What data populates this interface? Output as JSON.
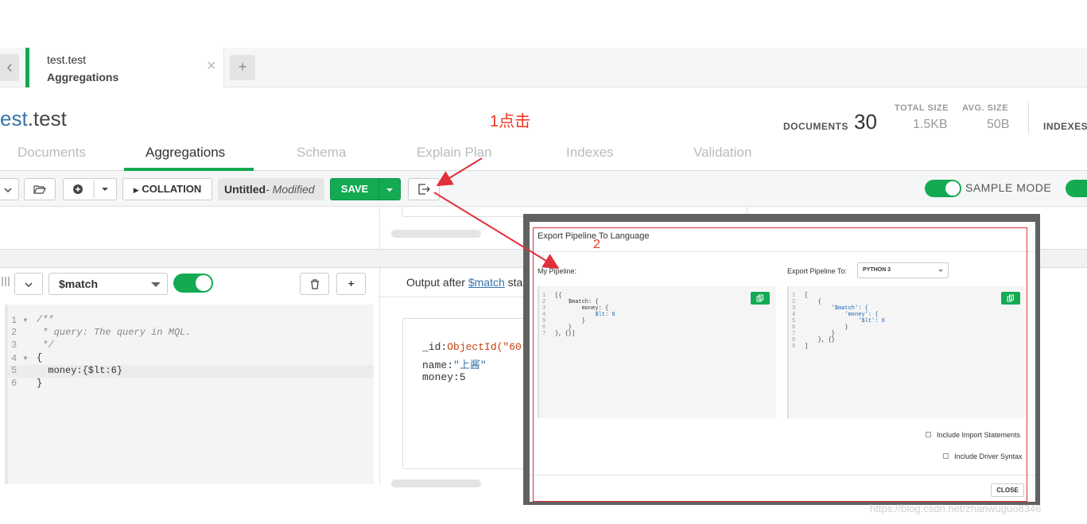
{
  "tabs": {
    "namespace": "test.test",
    "subtitle": "Aggregations",
    "close_glyph": "×",
    "add_glyph": "+",
    "back_glyph": "‹"
  },
  "header": {
    "db": "est",
    "coll": ".test",
    "annotation_1": "1点击",
    "documents_label": "DOCUMENTS",
    "documents_value": "30",
    "total_size_label": "TOTAL SIZE",
    "total_size_value": "1.5KB",
    "avg_size_label": "AVG. SIZE",
    "avg_size_value": "50B",
    "indexes_label": "INDEXES"
  },
  "main_tabs": [
    "Documents",
    "Aggregations",
    "Schema",
    "Explain Plan",
    "Indexes",
    "Validation"
  ],
  "toolbar": {
    "collation_label": "COLLATION",
    "pipeline_name": "Untitled",
    "modified_label": "- Modified",
    "save_label": "SAVE",
    "sample_mode_label": "SAMPLE MODE"
  },
  "stage": {
    "operator": "$match",
    "delete_glyph": "🗑",
    "add_glyph": "+",
    "output_prefix": "Output after ",
    "output_operator": "$match",
    "output_suffix": " sta",
    "code": [
      {
        "n": "1",
        "text": "/**"
      },
      {
        "n": "2",
        "text": " * query: The query in MQL."
      },
      {
        "n": "3",
        "text": " */"
      },
      {
        "n": "4",
        "text": "{"
      },
      {
        "n": "5",
        "text": "  money:{$lt:6}"
      },
      {
        "n": "6",
        "text": "}"
      }
    ]
  },
  "output_doc": {
    "id_key": "_id:",
    "id_val": "ObjectId(\"60",
    "name_key": "name:",
    "name_val": "\"上酱\"",
    "money_key": "money:",
    "money_val": "5"
  },
  "modal": {
    "title": "Export Pipeline To Language",
    "annotation_2": "2",
    "my_pipeline_label": "My Pipeline:",
    "export_to_label": "Export Pipeline To:",
    "language_selected": "PYTHON 3",
    "left_code": [
      {
        "n": "1",
        "text": "[{"
      },
      {
        "n": "2",
        "text": "    $match: {"
      },
      {
        "n": "3",
        "text": "        money: {"
      },
      {
        "n": "4",
        "text": "            $lt: 6"
      },
      {
        "n": "5",
        "text": "        }"
      },
      {
        "n": "6",
        "text": "    }"
      },
      {
        "n": "7",
        "text": "}, {}]"
      }
    ],
    "right_code": [
      {
        "n": "1",
        "text": "["
      },
      {
        "n": "2",
        "text": "    {"
      },
      {
        "n": "3",
        "text": "        '$match': {"
      },
      {
        "n": "4",
        "text": "            'money': {"
      },
      {
        "n": "5",
        "text": "                '$lt': 6"
      },
      {
        "n": "6",
        "text": "            }"
      },
      {
        "n": "7",
        "text": "        }"
      },
      {
        "n": "8",
        "text": "    }, {}"
      },
      {
        "n": "9",
        "text": "]"
      }
    ],
    "include_imports_label": "Include Import Statements",
    "include_driver_label": "Include Driver Syntax",
    "close_label": "CLOSE"
  },
  "watermark": "https://blog.csdn.net/zhanwuguo8346",
  "colors": {
    "accent": "#13aa52",
    "annotation": "#e0303a",
    "db_blue": "#3a73ab"
  }
}
